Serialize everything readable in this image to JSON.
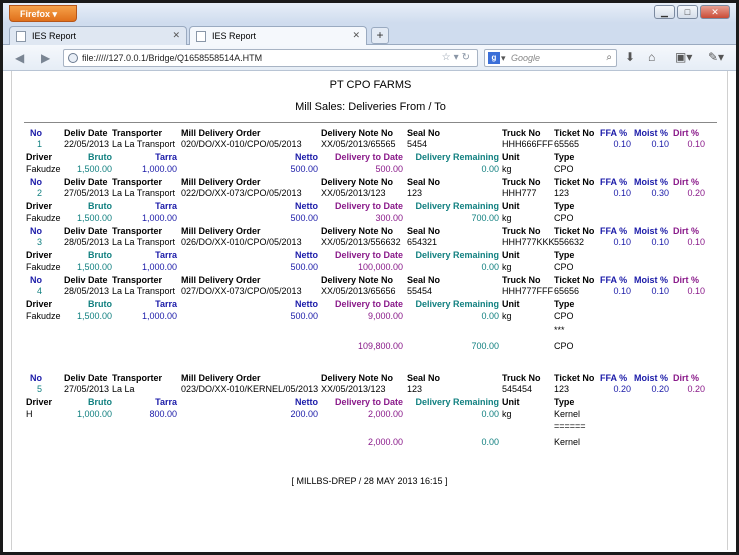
{
  "browser": {
    "app_button": "Firefox",
    "tabs": [
      {
        "label": "IES Report"
      },
      {
        "label": "IES Report"
      }
    ],
    "url": "file://///127.0.0.1/Bridge/Q1658558514A.HTM",
    "search_placeholder": "Google"
  },
  "report": {
    "company": "PT CPO FARMS",
    "title": "Mill Sales: Deliveries From / To",
    "headers": {
      "no": "No",
      "deliv_date": "Deliv Date",
      "transporter": "Transporter",
      "mill_delivery_order": "Mill Delivery Order",
      "delivery_note_no": "Delivery Note No",
      "seal_no": "Seal No",
      "truck_no": "Truck No",
      "ticket_no": "Ticket No",
      "ffa": "FFA %",
      "moist": "Moist %",
      "dirt": "Dirt %",
      "driver": "Driver",
      "bruto": "Bruto",
      "tarra": "Tarra",
      "netto": "Netto",
      "delivery_to_date": "Delivery to Date",
      "delivery_remaining": "Delivery Remaining",
      "unit": "Unit",
      "type": "Type"
    },
    "records": [
      {
        "no": "1",
        "date": "22/05/2013",
        "transporter": "La La Transport",
        "order": "020/DO/XX-010/CPO/05/2013",
        "note": "XX/05/2013/65565",
        "seal": "5454",
        "truck": "HHH666FFF",
        "ticket": "65565",
        "ffa": "0.10",
        "moist": "0.10",
        "dirt": "0.10",
        "driver": "Fakudze",
        "bruto": "1,500.00",
        "tarra": "1,000.00",
        "netto": "500.00",
        "to_date": "500.00",
        "remaining": "0.00",
        "unit": "kg",
        "type": "CPO"
      },
      {
        "no": "2",
        "date": "27/05/2013",
        "transporter": "La La Transport",
        "order": "022/DO/XX-073/CPO/05/2013",
        "note": "XX/05/2013/123",
        "seal": "123",
        "truck": "HHH777",
        "ticket": "123",
        "ffa": "0.10",
        "moist": "0.30",
        "dirt": "0.20",
        "driver": "Fakudze",
        "bruto": "1,500.00",
        "tarra": "1,000.00",
        "netto": "500.00",
        "to_date": "300.00",
        "remaining": "700.00",
        "unit": "kg",
        "type": "CPO"
      },
      {
        "no": "3",
        "date": "28/05/2013",
        "transporter": "La La Transport",
        "order": "026/DO/XX-010/CPO/05/2013",
        "note": "XX/05/2013/556632",
        "seal": "654321",
        "truck": "HHH777KKK",
        "ticket": "556632",
        "ffa": "0.10",
        "moist": "0.10",
        "dirt": "0.10",
        "driver": "Fakudze",
        "bruto": "1,500.00",
        "tarra": "1,000.00",
        "netto": "500.00",
        "to_date": "100,000.00",
        "remaining": "0.00",
        "unit": "kg",
        "type": "CPO"
      },
      {
        "no": "4",
        "date": "28/05/2013",
        "transporter": "La La Transport",
        "order": "027/DO/XX-073/CPO/05/2013",
        "note": "XX/05/2013/65656",
        "seal": "55454",
        "truck": "HHH777FFF",
        "ticket": "65656",
        "ffa": "0.10",
        "moist": "0.10",
        "dirt": "0.10",
        "driver": "Fakudze",
        "bruto": "1,500.00",
        "tarra": "1,000.00",
        "netto": "500.00",
        "to_date": "9,000.00",
        "remaining": "0.00",
        "unit": "kg",
        "type": "CPO"
      }
    ],
    "cpo_subtotal": {
      "separator": "***",
      "to_date": "109,800.00",
      "remaining": "700.00",
      "type": "CPO"
    },
    "kernel_record": {
      "no": "5",
      "date": "27/05/2013",
      "transporter": "La La",
      "order": "023/DO/XX-010/KERNEL/05/2013",
      "note": "XX/05/2013/123",
      "seal": "123",
      "truck": "545454",
      "ticket": "123",
      "ffa": "0.20",
      "moist": "0.20",
      "dirt": "0.20",
      "driver": "H",
      "bruto": "1,000.00",
      "tarra": "800.00",
      "netto": "200.00",
      "to_date": "2,000.00",
      "remaining": "0.00",
      "unit": "kg",
      "type": "Kernel"
    },
    "kernel_subtotal": {
      "separator": "======",
      "to_date": "2,000.00",
      "remaining": "0.00",
      "type": "Kernel"
    },
    "footer": "[ MILLBS-DREP / 28 MAY 2013 16:15 ]"
  },
  "colors": {
    "blue": "#1a1aa8",
    "teal": "#128080",
    "purple": "#8a1a8a",
    "firefox_orange": "#e0701b"
  }
}
